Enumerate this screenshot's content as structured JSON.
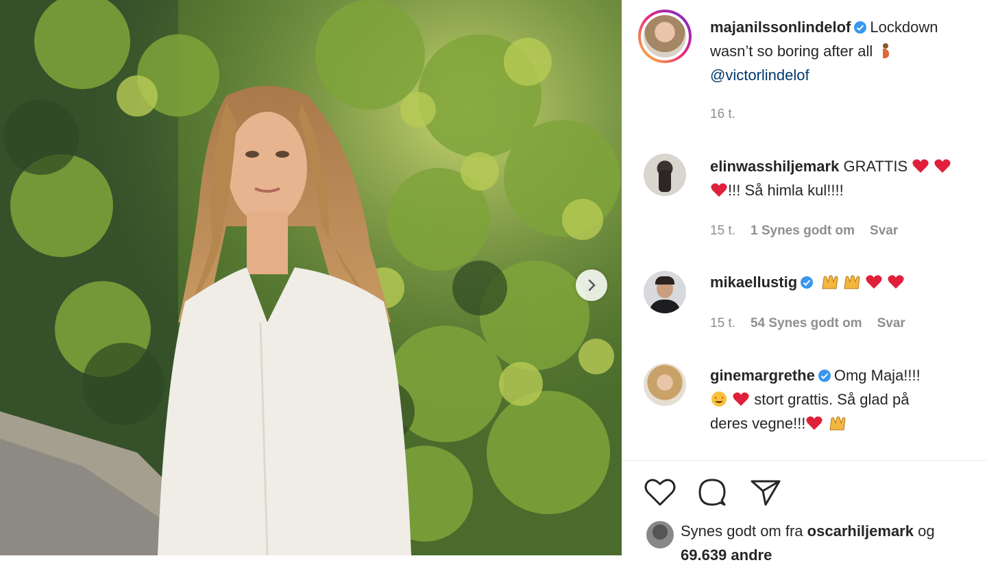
{
  "post": {
    "author": "majanilssonlindelof",
    "caption_text": "Lockdown wasn’t so boring after all",
    "mention": "@victorlindelof",
    "time": "16 t."
  },
  "comments": [
    {
      "user": "elinwasshiljemark",
      "verified": false,
      "text_line1": "GRATTIS",
      "text_line2": "!!! Så himla kul!!!!",
      "time": "15 t.",
      "likes": "1 Synes godt om",
      "reply": "Svar"
    },
    {
      "user": "mikaellustig",
      "verified": true,
      "text_line1": "",
      "time": "15 t.",
      "likes": "54 Synes godt om",
      "reply": "Svar"
    },
    {
      "user": "ginemargrethe",
      "verified": true,
      "text_line1": "Omg Maja!!!!",
      "text_line2": "stort grattis. Så glad på",
      "text_line3": "deres vegne!!!"
    }
  ],
  "likes_bar": {
    "prefix": "Synes godt om fra",
    "liker": "oscarhiljemark",
    "suffix": "og",
    "others": "69.639 andre"
  },
  "colors": {
    "verified": "#3897f0",
    "heart": "#e0203a",
    "muted": "#8e8e8e",
    "mention": "#00376b"
  },
  "icons": [
    "heart-icon",
    "comment-icon",
    "share-icon",
    "chevron-right-icon",
    "verified-icon",
    "pregnant-emoji",
    "raising-hands-emoji",
    "star-eyes-emoji"
  ]
}
